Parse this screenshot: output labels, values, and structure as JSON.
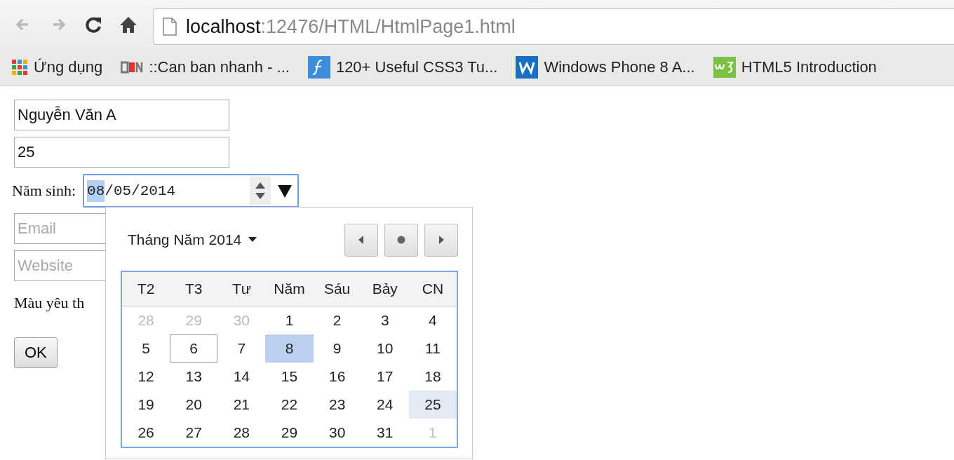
{
  "browser": {
    "address": {
      "host": "localhost",
      "path": ":12476/HTML/HtmlPage1.html"
    },
    "bookmarks": [
      {
        "label": "Ứng dụng",
        "kind": "apps"
      },
      {
        "label": "::Can ban nhanh - ...",
        "kind": "cbn"
      },
      {
        "label": "120+ Useful CSS3 Tu...",
        "kind": "f"
      },
      {
        "label": "Windows Phone 8 A...",
        "kind": "w"
      },
      {
        "label": "HTML5 Introduction",
        "kind": "w3"
      }
    ]
  },
  "form": {
    "name_value": "Nguyễn Văn A",
    "age_value": "25",
    "birth_label": "Năm sinh:",
    "date_segments": [
      {
        "text": "08",
        "selected": true
      },
      {
        "text": "/05/2014",
        "selected": false
      }
    ],
    "email_placeholder": "Email",
    "website_placeholder": "Website",
    "color_label": "Màu yêu th",
    "ok_button": "OK"
  },
  "calendar": {
    "month_label": "Tháng Năm 2014",
    "weekdays": [
      "T2",
      "T3",
      "Tư",
      "Năm",
      "Sáu",
      "Bảy",
      "CN"
    ],
    "weeks": [
      [
        {
          "label": "28",
          "outside": true,
          "selected": false,
          "today": false,
          "hover": false
        },
        {
          "label": "29",
          "outside": true,
          "selected": false,
          "today": false,
          "hover": false
        },
        {
          "label": "30",
          "outside": true,
          "selected": false,
          "today": false,
          "hover": false
        },
        {
          "label": "1",
          "outside": false,
          "selected": false,
          "today": false,
          "hover": false
        },
        {
          "label": "2",
          "outside": false,
          "selected": false,
          "today": false,
          "hover": false
        },
        {
          "label": "3",
          "outside": false,
          "selected": false,
          "today": false,
          "hover": false
        },
        {
          "label": "4",
          "outside": false,
          "selected": false,
          "today": false,
          "hover": false
        }
      ],
      [
        {
          "label": "5",
          "outside": false,
          "selected": false,
          "today": false,
          "hover": false
        },
        {
          "label": "6",
          "outside": false,
          "selected": false,
          "today": true,
          "hover": false
        },
        {
          "label": "7",
          "outside": false,
          "selected": false,
          "today": false,
          "hover": false
        },
        {
          "label": "8",
          "outside": false,
          "selected": true,
          "today": false,
          "hover": false
        },
        {
          "label": "9",
          "outside": false,
          "selected": false,
          "today": false,
          "hover": false
        },
        {
          "label": "10",
          "outside": false,
          "selected": false,
          "today": false,
          "hover": false
        },
        {
          "label": "11",
          "outside": false,
          "selected": false,
          "today": false,
          "hover": false
        }
      ],
      [
        {
          "label": "12",
          "outside": false,
          "selected": false,
          "today": false,
          "hover": false
        },
        {
          "label": "13",
          "outside": false,
          "selected": false,
          "today": false,
          "hover": false
        },
        {
          "label": "14",
          "outside": false,
          "selected": false,
          "today": false,
          "hover": false
        },
        {
          "label": "15",
          "outside": false,
          "selected": false,
          "today": false,
          "hover": false
        },
        {
          "label": "16",
          "outside": false,
          "selected": false,
          "today": false,
          "hover": false
        },
        {
          "label": "17",
          "outside": false,
          "selected": false,
          "today": false,
          "hover": false
        },
        {
          "label": "18",
          "outside": false,
          "selected": false,
          "today": false,
          "hover": false
        }
      ],
      [
        {
          "label": "19",
          "outside": false,
          "selected": false,
          "today": false,
          "hover": false
        },
        {
          "label": "20",
          "outside": false,
          "selected": false,
          "today": false,
          "hover": false
        },
        {
          "label": "21",
          "outside": false,
          "selected": false,
          "today": false,
          "hover": false
        },
        {
          "label": "22",
          "outside": false,
          "selected": false,
          "today": false,
          "hover": false
        },
        {
          "label": "23",
          "outside": false,
          "selected": false,
          "today": false,
          "hover": false
        },
        {
          "label": "24",
          "outside": false,
          "selected": false,
          "today": false,
          "hover": false
        },
        {
          "label": "25",
          "outside": false,
          "selected": false,
          "today": false,
          "hover": true
        }
      ],
      [
        {
          "label": "26",
          "outside": false,
          "selected": false,
          "today": false,
          "hover": false
        },
        {
          "label": "27",
          "outside": false,
          "selected": false,
          "today": false,
          "hover": false
        },
        {
          "label": "28",
          "outside": false,
          "selected": false,
          "today": false,
          "hover": false
        },
        {
          "label": "29",
          "outside": false,
          "selected": false,
          "today": false,
          "hover": false
        },
        {
          "label": "30",
          "outside": false,
          "selected": false,
          "today": false,
          "hover": false
        },
        {
          "label": "31",
          "outside": false,
          "selected": false,
          "today": false,
          "hover": false
        },
        {
          "label": "1",
          "outside": true,
          "selected": false,
          "today": false,
          "hover": false
        }
      ]
    ]
  }
}
